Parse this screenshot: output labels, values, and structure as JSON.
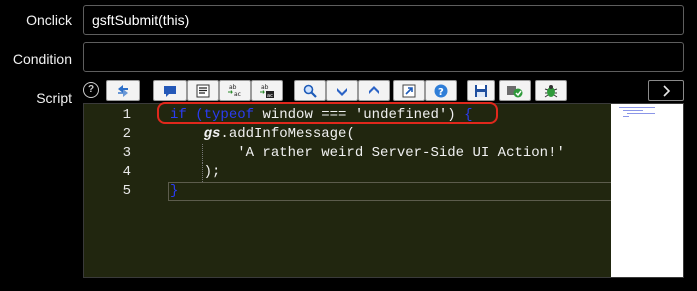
{
  "fields": {
    "onclick": {
      "label": "Onclick",
      "value": "gsftSubmit(this)"
    },
    "condition": {
      "label": "Condition",
      "value": ""
    },
    "script": {
      "label": "Script"
    }
  },
  "help_glyph": "?",
  "toolbar": [
    {
      "name": "toggle-syntax-editor-button",
      "icon": "toggle-editor-icon"
    },
    {
      "name": "insert-comment-button",
      "icon": "comment-icon"
    },
    {
      "name": "format-code-button",
      "icon": "format-icon"
    },
    {
      "name": "replace-button",
      "icon": "replace-icon"
    },
    {
      "name": "replace-all-button",
      "icon": "replace-all-icon"
    },
    {
      "name": "search-button",
      "icon": "search-icon"
    },
    {
      "name": "fold-code-button",
      "icon": "chevron-down-icon"
    },
    {
      "name": "unfold-code-button",
      "icon": "chevron-up-icon"
    },
    {
      "name": "full-screen-button",
      "icon": "expand-arrow-icon"
    },
    {
      "name": "help-button",
      "icon": "help-icon"
    },
    {
      "name": "save-button",
      "icon": "save-icon"
    },
    {
      "name": "script-debugger-button",
      "icon": "debugger-icon"
    },
    {
      "name": "script-check-button",
      "icon": "bug-icon"
    },
    {
      "name": "expand-panel-button",
      "icon": "chevron-right-icon"
    }
  ],
  "editor": {
    "line_numbers": [
      "1",
      "2",
      "3",
      "4",
      "5"
    ],
    "line1": {
      "kw1": "if",
      "paren_open": " (",
      "kw2": "typeof",
      "rest": " window === 'undefined') ",
      "brace": "{"
    },
    "line2": {
      "obj": "gs",
      "rest": ".addInfoMessage("
    },
    "line3": {
      "text": "'A rather weird Server-Side UI Action!'"
    },
    "line4": {
      "text": ");"
    },
    "line5": {
      "brace": "}"
    }
  },
  "colors": {
    "editor_bg": "#21260f",
    "keyword": "#2a3cf2",
    "highlight_box": "#e0281c"
  }
}
